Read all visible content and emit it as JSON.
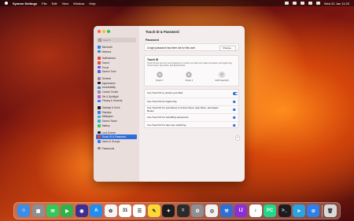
{
  "menubar": {
    "app_name": "System Settings",
    "menus": [
      "File",
      "Edit",
      "View",
      "Window",
      "Help"
    ],
    "clock": "Wed 31 Jan  11:20"
  },
  "search": {
    "placeholder": "Search"
  },
  "sidebar": {
    "groups": [
      [
        {
          "label": "Bluetooth",
          "color": "#2f80ed",
          "icon": "bluetooth-icon"
        },
        {
          "label": "Network",
          "color": "#2f80ed",
          "icon": "globe-icon"
        }
      ],
      [
        {
          "label": "Notifications",
          "color": "#e8453c",
          "icon": "bell-icon"
        },
        {
          "label": "Sound",
          "color": "#e8453c",
          "icon": "speaker-icon"
        },
        {
          "label": "Focus",
          "color": "#5e5ce6",
          "icon": "moon-icon"
        },
        {
          "label": "Screen Time",
          "color": "#5e5ce6",
          "icon": "hourglass-icon"
        }
      ],
      [
        {
          "label": "General",
          "color": "#8e8e93",
          "icon": "gear-icon"
        },
        {
          "label": "Appearance",
          "color": "#1c1c1e",
          "icon": "appearance-icon"
        },
        {
          "label": "Accessibility",
          "color": "#2f80ed",
          "icon": "accessibility-icon"
        },
        {
          "label": "Control Centre",
          "color": "#8e8e93",
          "icon": "control-centre-icon"
        },
        {
          "label": "Siri & Spotlight",
          "color": "#c05bd6",
          "icon": "siri-icon"
        },
        {
          "label": "Privacy & Security",
          "color": "#2f80ed",
          "icon": "hand-icon"
        }
      ],
      [
        {
          "label": "Desktop & Dock",
          "color": "#1c1c1e",
          "icon": "dock-icon"
        },
        {
          "label": "Displays",
          "color": "#2f80ed",
          "icon": "sun-icon"
        },
        {
          "label": "Wallpaper",
          "color": "#34aadc",
          "icon": "wallpaper-icon"
        },
        {
          "label": "Screen Saver",
          "color": "#34aadc",
          "icon": "screen-saver-icon"
        },
        {
          "label": "Battery",
          "color": "#34c759",
          "icon": "battery-icon"
        }
      ],
      [
        {
          "label": "Lock Screen",
          "color": "#1c1c1e",
          "icon": "lock-icon"
        },
        {
          "label": "Touch ID & Password",
          "color": "#e8453c",
          "icon": "fingerprint-icon",
          "selected": true
        },
        {
          "label": "Users & Groups",
          "color": "#2f80ed",
          "icon": "users-icon"
        }
      ],
      [
        {
          "label": "Passwords",
          "color": "#8e8e93",
          "icon": "key-icon"
        }
      ]
    ]
  },
  "main": {
    "title": "Touch ID & Password",
    "password_section": "Password",
    "password_text": "A login password has been set for this user.",
    "change_button": "Change...",
    "touchid_title": "Touch ID",
    "touchid_desc": "Touch ID lets you use your fingerprint to unlock your Mac and make purchases with Apple Pay, iTunes Store, App Store, and Apple Books.",
    "fingers": [
      "Finger 1",
      "Finger 2",
      "Add Fingerprint"
    ],
    "toggles": [
      {
        "label": "Use Touch ID to unlock your Mac",
        "on": true
      },
      {
        "label": "Use Touch ID for Apple Pay",
        "on": true
      },
      {
        "label": "Use Touch ID for purchases in iTunes Store, App Store, and Apple Books",
        "on": true
      },
      {
        "label": "Use Touch ID for autofilling passwords",
        "on": true
      },
      {
        "label": "Use Touch ID for fast user switching",
        "on": true
      }
    ],
    "help": "?"
  },
  "dock": {
    "apps": [
      {
        "name": "finder",
        "bg": "#3a8ee6",
        "glyph": "☺"
      },
      {
        "name": "launchpad",
        "bg": "#8e8e93",
        "glyph": "▦"
      },
      {
        "name": "messages",
        "bg": "#34c759",
        "glyph": "✉"
      },
      {
        "name": "facetime",
        "bg": "#30b14c",
        "glyph": "▶"
      },
      {
        "name": "siri",
        "bg": "#3b2f8f",
        "glyph": "◉"
      },
      {
        "name": "app-store",
        "bg": "#1f8ef1",
        "glyph": "A"
      },
      {
        "name": "photos",
        "bg": "#f5f5f5",
        "glyph": "✿"
      },
      {
        "name": "calendar",
        "bg": "#ffffff",
        "glyph": "31"
      },
      {
        "name": "reminders",
        "bg": "#ffffff",
        "glyph": "☰"
      },
      {
        "name": "notes",
        "bg": "#fdd835",
        "glyph": "✎"
      },
      {
        "name": "tv",
        "bg": "#1c1c1e",
        "glyph": "✦"
      },
      {
        "name": "calculator",
        "bg": "#2b2b2b",
        "glyph": "="
      },
      {
        "name": "system-settings",
        "bg": "#8e8e93",
        "glyph": "⚙"
      },
      {
        "name": "chrome",
        "bg": "#f2f2f2",
        "glyph": "◎"
      },
      {
        "name": "xcode",
        "bg": "#2d6fd6",
        "glyph": "⚒"
      },
      {
        "name": "intellij",
        "bg": "#8b2fd9",
        "glyph": "IJ"
      },
      {
        "name": "music",
        "bg": "#ffffff",
        "glyph": "♪"
      },
      {
        "name": "pycharm",
        "bg": "#21d789",
        "glyph": "PC"
      },
      {
        "name": "terminal",
        "bg": "#1c1c1e",
        "glyph": ">_"
      },
      {
        "name": "telegram",
        "bg": "#2aa3e0",
        "glyph": "➤"
      },
      {
        "name": "safari",
        "bg": "#2f80ed",
        "glyph": "⊘"
      }
    ],
    "trash": {
      "name": "trash",
      "bg": "#d9d9d9",
      "glyph": "🗑"
    }
  }
}
